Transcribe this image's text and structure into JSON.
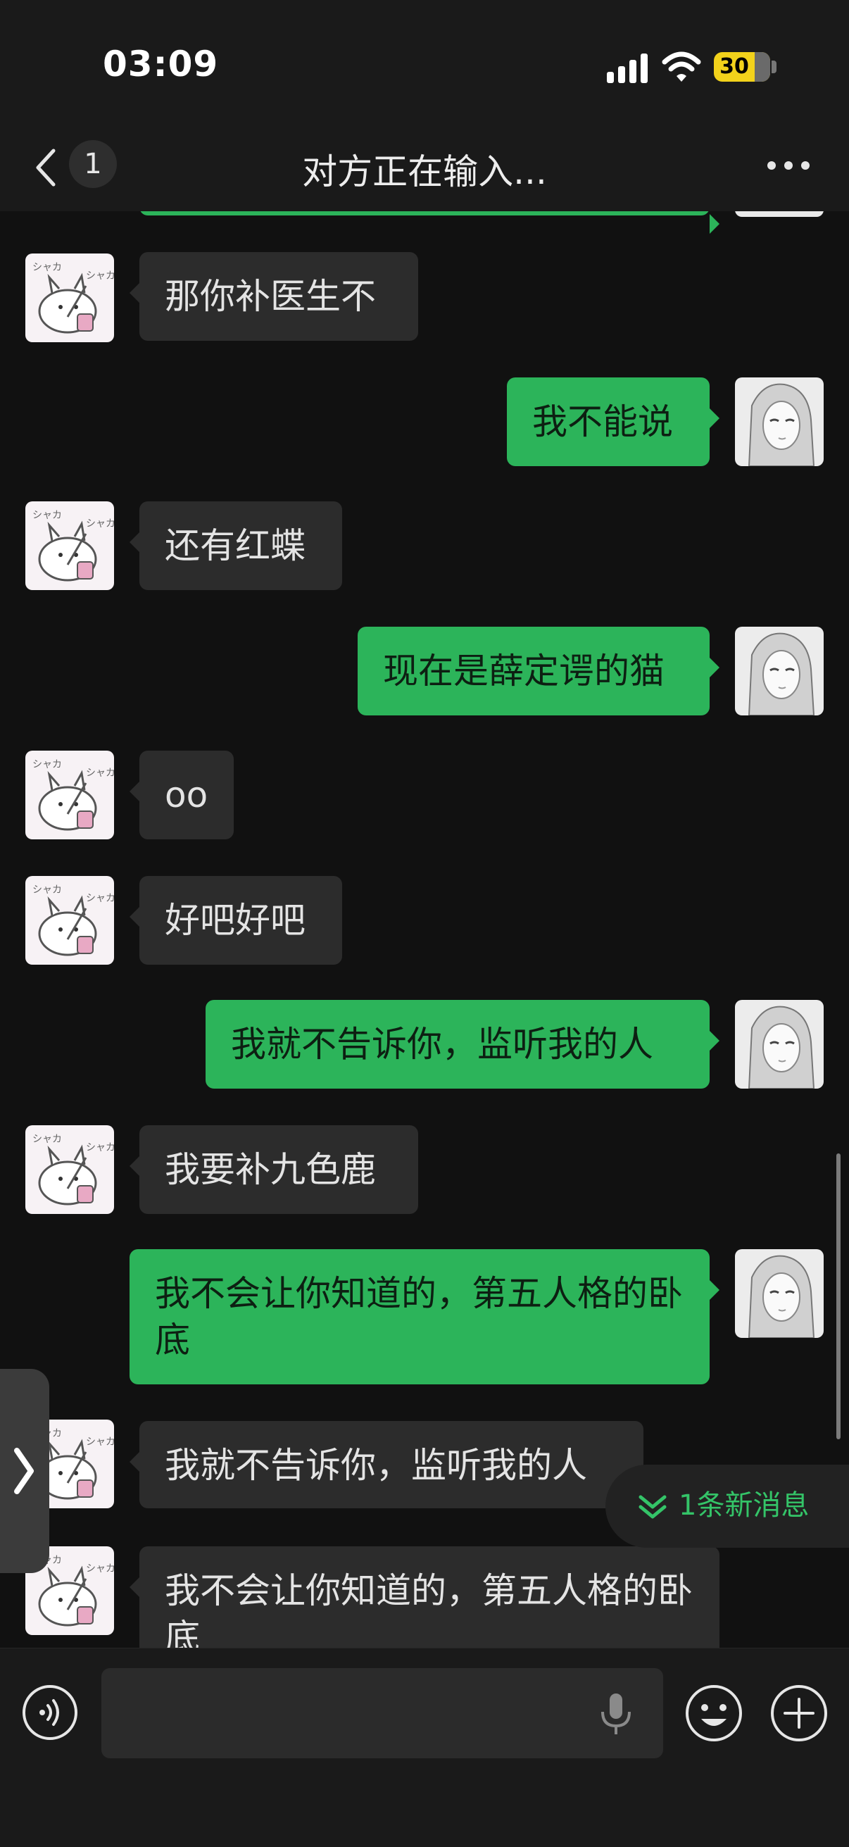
{
  "status_bar": {
    "time": "03:09",
    "battery": "30"
  },
  "nav": {
    "unread_count": "1",
    "title": "对方正在输入..."
  },
  "messages": [
    {
      "side": "out",
      "text": ""
    },
    {
      "side": "in",
      "text": "那你补医生不"
    },
    {
      "side": "out",
      "text": "我不能说"
    },
    {
      "side": "in",
      "text": "还有红蝶"
    },
    {
      "side": "out",
      "text": "现在是薛定谔的猫"
    },
    {
      "side": "in",
      "text": "oo"
    },
    {
      "side": "in",
      "text": "好吧好吧"
    },
    {
      "side": "out",
      "text": "我就不告诉你，监听我的人"
    },
    {
      "side": "in",
      "text": "我要补九色鹿"
    },
    {
      "side": "out",
      "text": "我不会让你知道的，第五人格的卧底"
    },
    {
      "side": "in",
      "text": "我就不告诉你，监听我的人"
    },
    {
      "side": "in",
      "text": "我不会让你知道的，第五人格的卧底"
    }
  ],
  "new_message_notice": "1条新消息",
  "input": {
    "value": "",
    "placeholder": ""
  },
  "colors": {
    "outgoing_bubble": "#2cb45a",
    "incoming_bubble": "#2c2c2c",
    "background": "#111111",
    "accent_green": "#34c468"
  }
}
